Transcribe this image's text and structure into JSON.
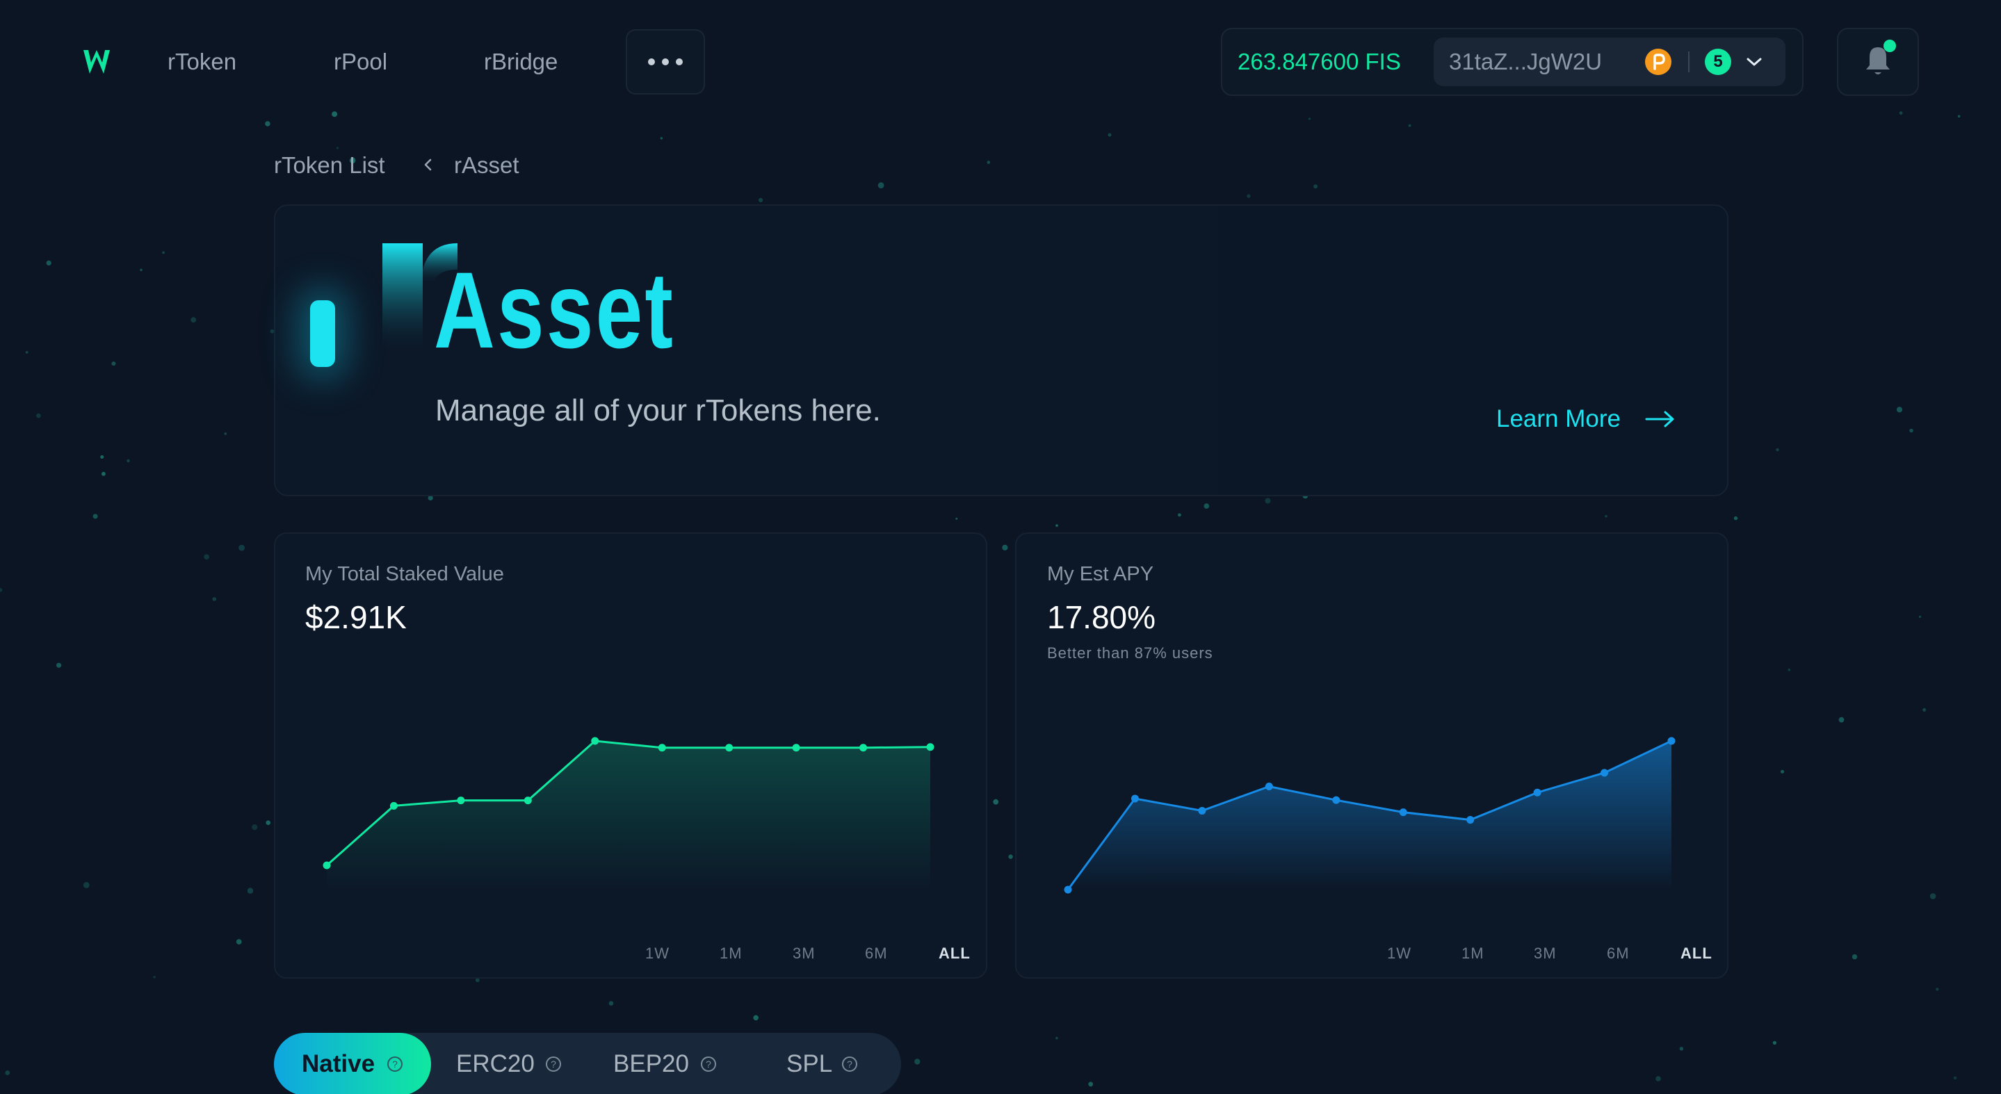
{
  "nav": {
    "items": [
      "rToken",
      "rPool",
      "rBridge"
    ]
  },
  "wallet": {
    "balance": "263.847600 FIS",
    "address": "31taZ...JgW2U",
    "network_count": "5"
  },
  "breadcrumb": {
    "parent": "rToken List",
    "current": "rAsset"
  },
  "hero": {
    "title_mark": "r",
    "title_rest": "Asset",
    "subtitle": "Manage all of your rTokens here.",
    "learn_more": "Learn More"
  },
  "cards": {
    "staked": {
      "title": "My Total Staked Value",
      "value": "$2.91K",
      "ranges": [
        "1W",
        "1M",
        "3M",
        "6M",
        "ALL"
      ],
      "active_range": "ALL"
    },
    "apy": {
      "title": "My Est APY",
      "value": "17.80%",
      "note": "Better than 87% users",
      "ranges": [
        "1W",
        "1M",
        "3M",
        "6M",
        "ALL"
      ],
      "active_range": "ALL"
    }
  },
  "tabs": {
    "items": [
      "Native",
      "ERC20",
      "BEP20",
      "SPL"
    ],
    "active": "Native"
  },
  "chart_data": [
    {
      "type": "area",
      "series": [
        {
          "values": [
            0.18,
            0.62,
            0.66,
            0.66,
            1.1,
            1.05,
            1.05,
            1.05,
            1.05,
            1.055
          ]
        }
      ],
      "color": "#10e8a0"
    },
    {
      "type": "area",
      "series": [
        {
          "values": [
            0.0,
            0.6,
            0.52,
            0.68,
            0.59,
            0.51,
            0.46,
            0.64,
            0.77,
            0.98
          ]
        }
      ],
      "color": "#168be6"
    }
  ],
  "colors": {
    "accent_cyan": "#1de3f0",
    "accent_green": "#10e8a0",
    "accent_blue": "#168be6",
    "background": "#0b1524"
  }
}
